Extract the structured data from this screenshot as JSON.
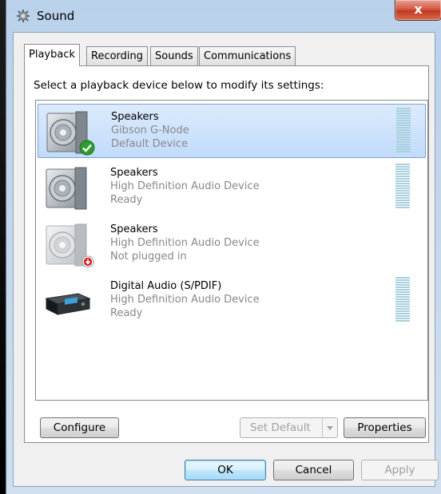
{
  "window": {
    "title": "Sound",
    "close_label": "x"
  },
  "tabs": [
    {
      "label": "Playback"
    },
    {
      "label": "Recording"
    },
    {
      "label": "Sounds"
    },
    {
      "label": "Communications"
    }
  ],
  "instruction": "Select a playback device below to modify its settings:",
  "devices": [
    {
      "name": "Speakers",
      "description": "Gibson G-Node",
      "status": "Default Device",
      "icon": "speaker-icon",
      "badge": "default-check-icon",
      "selected": true
    },
    {
      "name": "Speakers",
      "description": "High Definition Audio Device",
      "status": "Ready",
      "icon": "speaker-icon"
    },
    {
      "name": "Speakers",
      "description": "High Definition Audio Device",
      "status": "Not plugged in",
      "icon": "speaker-icon",
      "badge": "unplugged-arrow-icon"
    },
    {
      "name": "Digital Audio (S/PDIF)",
      "description": "High Definition Audio Device",
      "status": "Ready",
      "icon": "digital-receiver-icon"
    }
  ],
  "buttons": {
    "configure": "Configure",
    "set_default": "Set Default",
    "properties": "Properties",
    "ok": "OK",
    "cancel": "Cancel",
    "apply": "Apply"
  },
  "colors": {
    "selection": "#c1dbfc",
    "meter": "#a9d1dc",
    "check": "#2e9c2e",
    "unplugged": "#d02020"
  }
}
